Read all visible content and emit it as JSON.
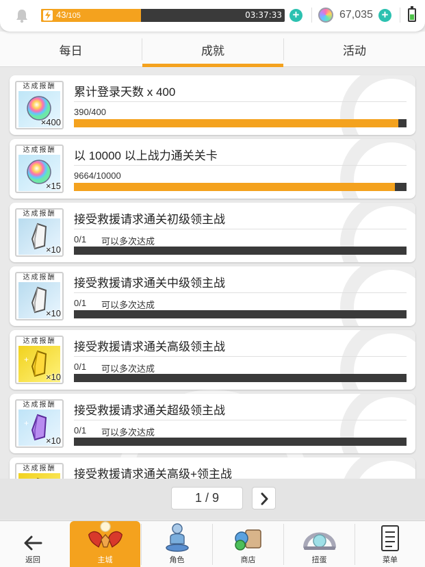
{
  "status": {
    "stamina_current": "43",
    "stamina_max": "/105",
    "stamina_fraction": 0.41,
    "timer": "03:37:33",
    "gems": "67,035"
  },
  "tabs": [
    {
      "label": "每日",
      "active": false
    },
    {
      "label": "成就",
      "active": true
    },
    {
      "label": "活动",
      "active": false
    }
  ],
  "reward_label": "达成报酬",
  "missions": [
    {
      "title": "累计登录天数 x 400",
      "progress": "390/400",
      "repeat": "",
      "fraction": 0.975,
      "reward_icon": "rainbow-gem-icon",
      "reward_count": "×400"
    },
    {
      "title": "以 10000 以上战力通关关卡",
      "progress": "9664/10000",
      "repeat": "",
      "fraction": 0.966,
      "reward_icon": "rainbow-gem-icon",
      "reward_count": "×15"
    },
    {
      "title": "接受救援请求通关初级领主战",
      "progress": "0/1",
      "repeat": "可以多次达成",
      "fraction": 0,
      "reward_icon": "silver-crystal-icon",
      "reward_count": "×10"
    },
    {
      "title": "接受救援请求通关中级领主战",
      "progress": "0/1",
      "repeat": "可以多次达成",
      "fraction": 0,
      "reward_icon": "silver-crystal-icon",
      "reward_count": "×10"
    },
    {
      "title": "接受救援请求通关高级领主战",
      "progress": "0/1",
      "repeat": "可以多次达成",
      "fraction": 0,
      "reward_icon": "gold-crystal-icon",
      "reward_count": "×10"
    },
    {
      "title": "接受救援请求通关超级领主战",
      "progress": "0/1",
      "repeat": "可以多次达成",
      "fraction": 0,
      "reward_icon": "purple-crystal-icon",
      "reward_count": "×10"
    },
    {
      "title": "接受救援请求通关高级+领主战",
      "progress": "",
      "repeat": "",
      "fraction": 0,
      "reward_icon": "gold-crystal-icon",
      "reward_count": ""
    }
  ],
  "pager": {
    "text": "1 / 9"
  },
  "nav": [
    {
      "label": "返回",
      "icon": "back-arrow-icon",
      "active": false
    },
    {
      "label": "主城",
      "icon": "castle-icon",
      "active": true
    },
    {
      "label": "角色",
      "icon": "character-icon",
      "active": false
    },
    {
      "label": "商店",
      "icon": "shop-icon",
      "active": false
    },
    {
      "label": "扭蛋",
      "icon": "gacha-icon",
      "active": false
    },
    {
      "label": "菜单",
      "icon": "menu-icon",
      "active": false
    }
  ],
  "colors": {
    "accent": "#f4a21e",
    "bar_dark": "#3a3a3a",
    "plus": "#2cc1b0"
  }
}
